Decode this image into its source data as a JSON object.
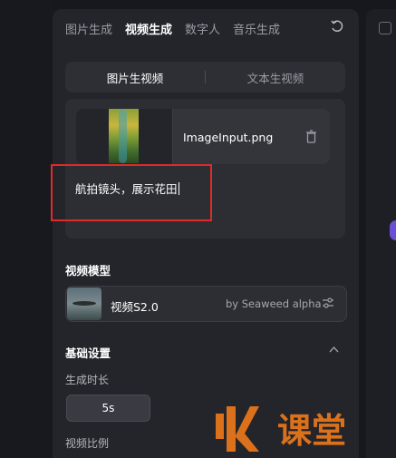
{
  "tabs": [
    {
      "label": "图片生成",
      "active": false
    },
    {
      "label": "视频生成",
      "active": true
    },
    {
      "label": "数字人",
      "active": false
    },
    {
      "label": "音乐生成",
      "active": false
    }
  ],
  "mode": {
    "options": [
      "图片生视频",
      "文本生视频"
    ],
    "selected": "图片生视频"
  },
  "upload": {
    "filename": "ImageInput.png"
  },
  "prompt": {
    "value": "航拍镜头，展示花田"
  },
  "model": {
    "section_label": "视频模型",
    "name": "视频S2.0",
    "provider": "by Seaweed alpha"
  },
  "basic": {
    "section_label": "基础设置",
    "duration_label": "生成时长",
    "duration_value": "5s",
    "ratio_label": "视频比例"
  },
  "watermark": {
    "text": "课堂"
  },
  "colors": {
    "panel": "#24252b",
    "card": "#2d2e34",
    "accent": "#6d4fd6",
    "highlight": "#e02a2a",
    "watermark": "#f07a1a"
  }
}
